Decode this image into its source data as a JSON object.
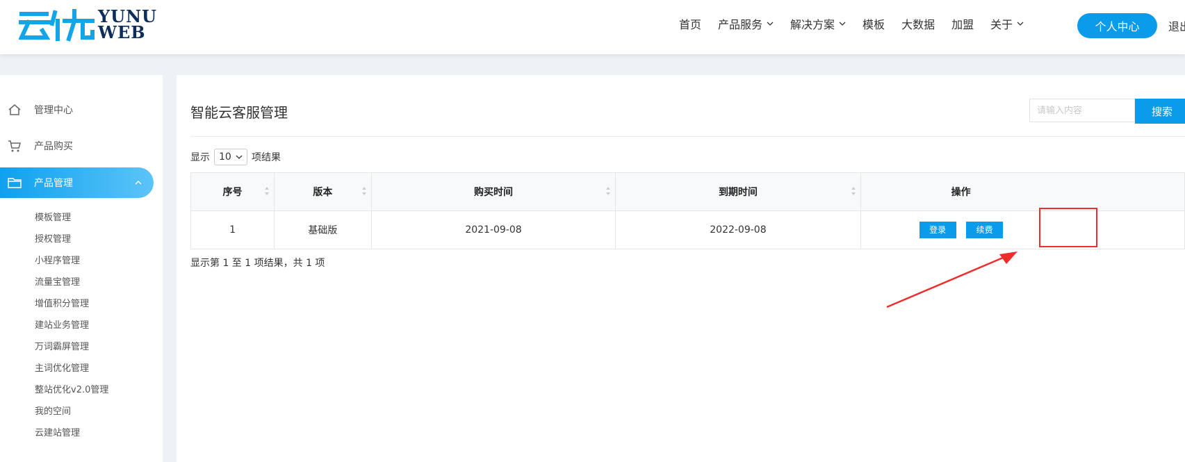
{
  "header": {
    "logo_cn": "云优",
    "logo_en_top": "YUNU",
    "logo_en_bottom": "WEB",
    "nav": [
      {
        "label": "首页",
        "has_dropdown": false
      },
      {
        "label": "产品服务",
        "has_dropdown": true
      },
      {
        "label": "解决方案",
        "has_dropdown": true
      },
      {
        "label": "模板",
        "has_dropdown": false
      },
      {
        "label": "大数据",
        "has_dropdown": false
      },
      {
        "label": "加盟",
        "has_dropdown": false
      },
      {
        "label": "关于",
        "has_dropdown": true
      }
    ],
    "user_center": "个人中心",
    "logout": "退出"
  },
  "sidebar": {
    "items": [
      {
        "label": "管理中心",
        "icon": "home-icon"
      },
      {
        "label": "产品购买",
        "icon": "cart-icon"
      },
      {
        "label": "产品管理",
        "icon": "folder-icon",
        "active": true
      }
    ],
    "sub_items": [
      "模板管理",
      "授权管理",
      "小程序管理",
      "流量宝管理",
      "增值积分管理",
      "建站业务管理",
      "万词霸屏管理",
      "主词优化管理",
      "整站优化v2.0管理",
      "我的空间",
      "云建站管理"
    ]
  },
  "main": {
    "title": "智能云客服管理",
    "search_placeholder": "请输入内容",
    "search_button": "搜索",
    "show_prefix": "显示",
    "page_size": "10",
    "show_suffix": "项结果",
    "columns": [
      "序号",
      "版本",
      "购买时间",
      "到期时间",
      "操作"
    ],
    "rows": [
      {
        "index": "1",
        "version": "基础版",
        "purchase": "2021-09-08",
        "expire": "2022-09-08",
        "login": "登录",
        "renew": "续费"
      }
    ],
    "info": "显示第 1 至 1 项结果，共 1 项"
  },
  "colors": {
    "accent": "#0a9bea",
    "annotation": "#ee2d2d"
  }
}
